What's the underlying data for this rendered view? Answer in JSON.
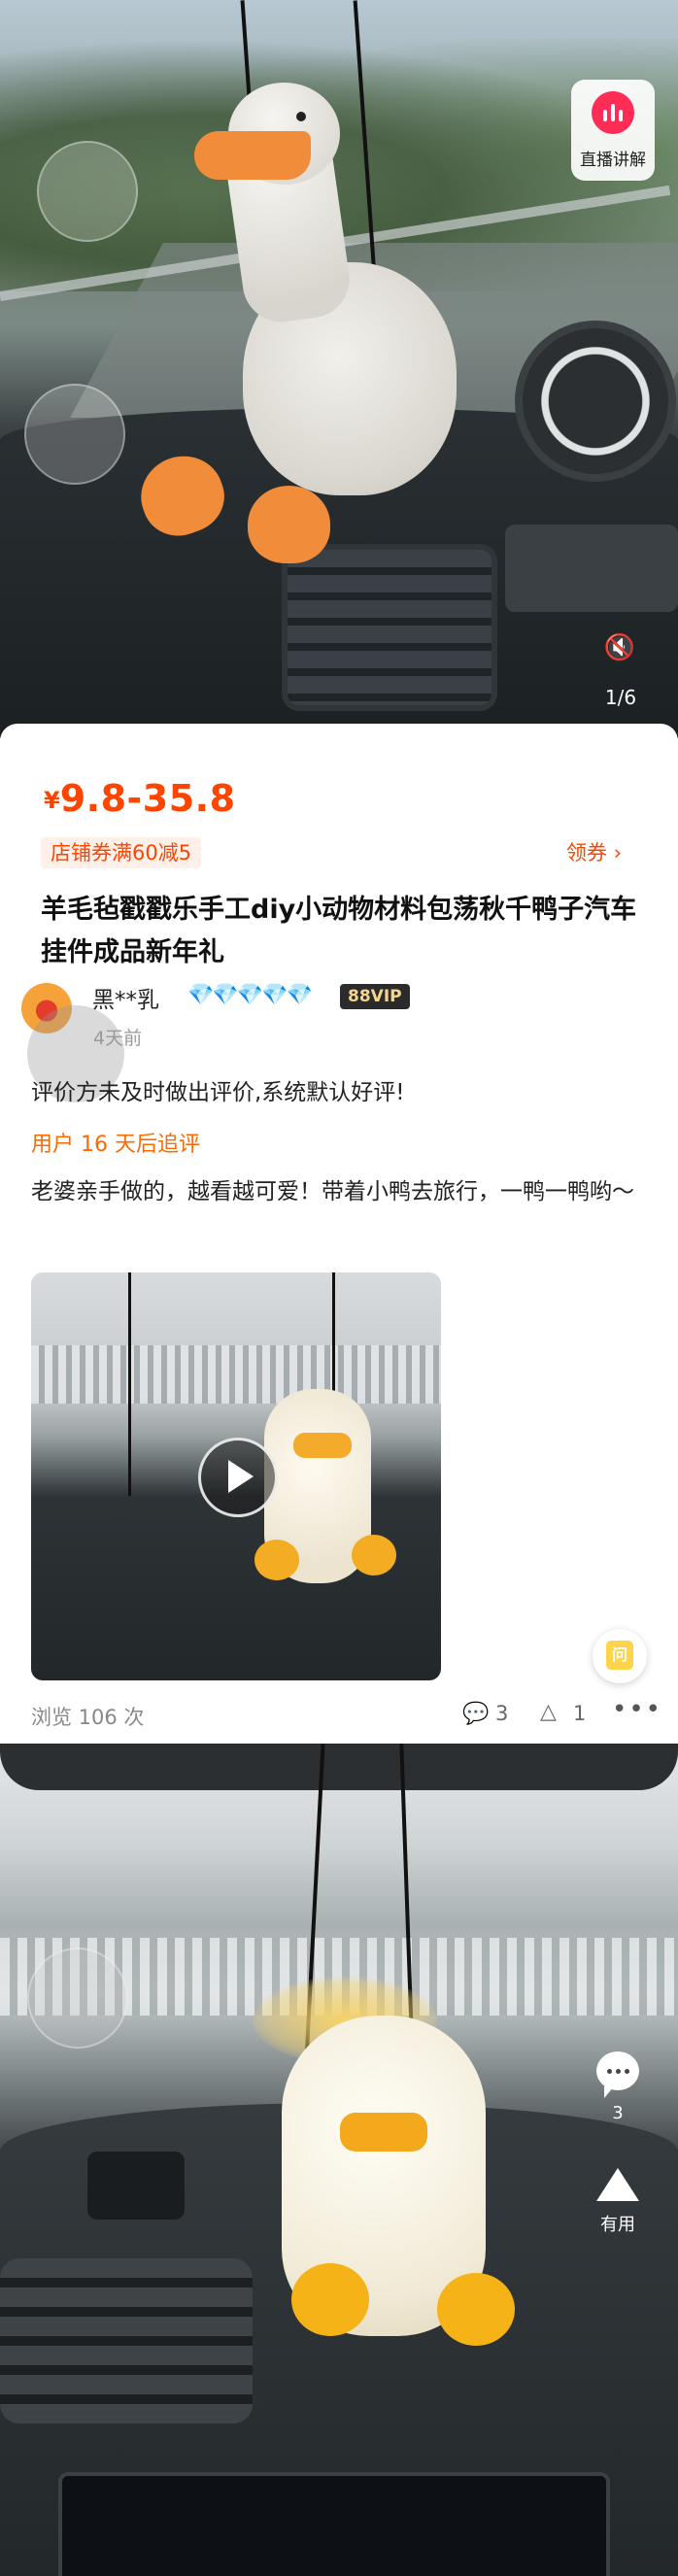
{
  "hero": {
    "live_label": "直播讲解",
    "image_counter": "1/6",
    "volume_icon": "mute-icon"
  },
  "product": {
    "price_symbol": "¥",
    "price": "9.8-35.8",
    "coupon": "店铺券满60减5",
    "claim": "领券 ›",
    "title": "羊毛毡戳戳乐手工diy小动物材料包荡秋千鸭子汽车挂件成品新年礼"
  },
  "review": {
    "username": "黑**乳",
    "diamonds": "💎💎💎💎💎",
    "vip_badge": "88VIP",
    "time": "4天前",
    "text": "评价方未及时做出评价,系统默认好评!",
    "followup_label": "用户 16 天后追评",
    "followup_text": "老婆亲手做的，越看越可爱！带着小鸭去旅行，一鸭一鸭哟～",
    "views": "浏览 106 次",
    "comment_count": "3",
    "like_count": "1",
    "more": "•••",
    "qa_icon": "问"
  },
  "photo2": {
    "side_comment_count": "3",
    "side_useful_label": "有用"
  },
  "colors": {
    "accent": "#ff4400",
    "followup": "#ff6a00",
    "live": "#ff2d55"
  }
}
